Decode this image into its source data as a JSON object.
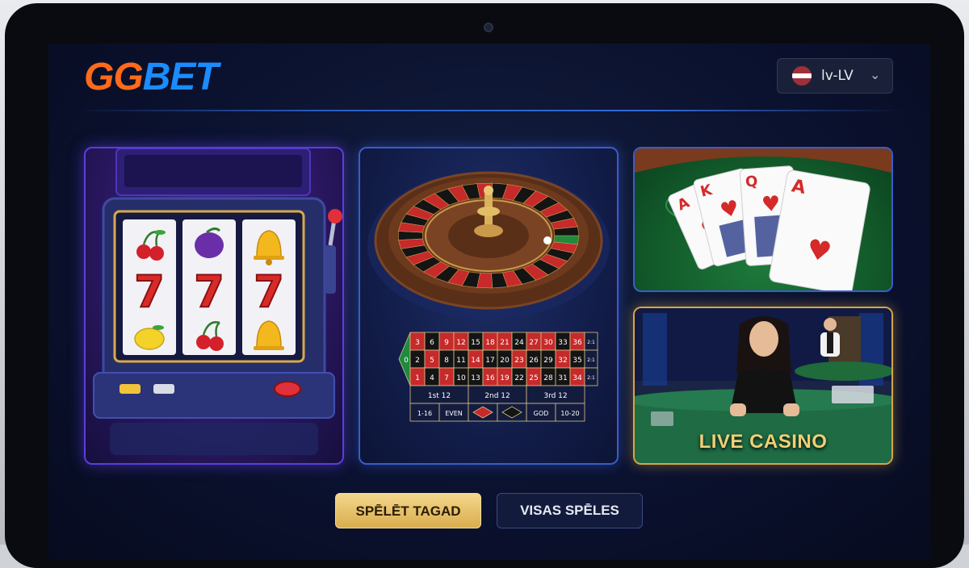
{
  "brand": {
    "logo_part1": "GG",
    "logo_part2": "BET",
    "color_gg": "#ff6a1a",
    "color_bet": "#1b8cff"
  },
  "language": {
    "label": "lv-LV",
    "flag_icon": "latvia-flag-icon",
    "chevron_icon": "chevron-down-icon"
  },
  "tiles": [
    {
      "id": "slots",
      "icon": "slot-machine-icon",
      "reels": [
        [
          "cherry",
          "seven",
          "lemon"
        ],
        [
          "plum",
          "seven",
          "cherry"
        ],
        [
          "bell",
          "seven",
          "bell"
        ]
      ],
      "reel_symbol_text": "7"
    },
    {
      "id": "roulette",
      "icon": "roulette-wheel-icon",
      "table": {
        "zero": "0",
        "rows": [
          [
            "3",
            "6",
            "9",
            "12",
            "15",
            "18",
            "21",
            "24",
            "27",
            "30",
            "33",
            "36"
          ],
          [
            "2",
            "5",
            "8",
            "11",
            "14",
            "17",
            "20",
            "23",
            "26",
            "29",
            "32",
            "35"
          ],
          [
            "1",
            "4",
            "7",
            "10",
            "13",
            "16",
            "19",
            "22",
            "25",
            "28",
            "31",
            "34"
          ]
        ],
        "red_numbers": [
          "1",
          "3",
          "5",
          "7",
          "9",
          "12",
          "14",
          "16",
          "18",
          "19",
          "21",
          "23",
          "25",
          "27",
          "30",
          "32",
          "34",
          "36"
        ],
        "column_bets": [
          "2:1",
          "2:1",
          "2:1"
        ],
        "dozens": [
          "1st 12",
          "2nd 12",
          "3rd 12"
        ],
        "outside_bets": [
          "1-16",
          "EVEN",
          "",
          "",
          "GOD",
          "10-20"
        ]
      }
    },
    {
      "id": "cards",
      "icon": "playing-cards-icon",
      "card_ranks": [
        "A",
        "K",
        "Q",
        "A"
      ]
    },
    {
      "id": "live",
      "icon": "live-dealer-icon",
      "label": "LIVE CASINO"
    }
  ],
  "buttons": {
    "play_now": "SPĒLĒT TAGAD",
    "all_games": "VISAS SPĒLES"
  },
  "colors": {
    "accent_gold": "#d9ad4e",
    "accent_blue": "#3468d6",
    "roulette_red": "#c62a2a",
    "table_green": "#1e7a3c"
  }
}
